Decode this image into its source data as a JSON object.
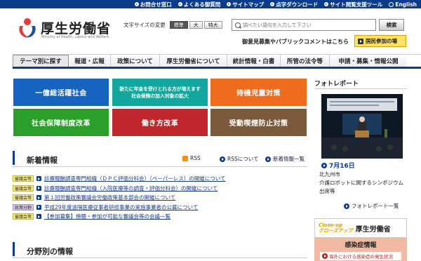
{
  "topbar": {
    "links": [
      {
        "label": "お問合せ窓口",
        "icon": "arrow-circle-icon"
      },
      {
        "label": "よくある御質問",
        "icon": "arrow-circle-icon"
      },
      {
        "label": "サイトマップ",
        "icon": "arrow-circle-icon"
      },
      {
        "label": "点字ダウンロード",
        "icon": "arrow-circle-icon"
      },
      {
        "label": "サイト閲覧支援ツール",
        "icon": "arrow-circle-icon"
      },
      {
        "label": "English",
        "icon": "globe-icon"
      }
    ]
  },
  "logo": {
    "name": "厚生労働省",
    "english": "Ministry of Health, Labour and Welfare"
  },
  "font_size": {
    "label": "文字サイズの変更",
    "options": [
      "標準",
      "大",
      "特大"
    ],
    "selected": "標準"
  },
  "search": {
    "placeholder": "調べたい語句を入力して下さい",
    "button": "検索"
  },
  "public_comment": "御意見募集やパブリックコメントはこちら",
  "kokumin_button": "国民参加の場",
  "nav": [
    "テーマ別に探す",
    "報道・広報",
    "政策について",
    "厚生労働省について",
    "統計情報・白書",
    "所管の法令等",
    "申請・募集・情報公開"
  ],
  "tiles": [
    {
      "label": "一億総活躍社会",
      "color": "#1565c0"
    },
    {
      "label": "新たに年金を受けとれる方が増えます\n社会保険の加入対象の拡大",
      "color": "#11a79f"
    },
    {
      "label": "待機児童対策",
      "color": "#ef6c1f"
    },
    {
      "label": "社会保障制度改革",
      "color": "#2aa02a"
    },
    {
      "label": "働き方改革",
      "color": "#c0272d"
    },
    {
      "label": "受動喫煙防止対策",
      "color": "#7b5a3c"
    }
  ],
  "news": {
    "title": "新着情報",
    "rss": "RSS",
    "rss_about": "RSSについて",
    "list_link": "新着情報一覧",
    "items": [
      {
        "tag": "審議会等",
        "text": "診療報酬調査専門組織（ＤＰＣ評価分科会）（ペーパーレス）の開催について"
      },
      {
        "tag": "審議会等",
        "text": "診療報酬調査専門組織（入院医療等の調査・評価分科会）の開催について"
      },
      {
        "tag": "審議会等",
        "text": "第１回労働政策審議会労働政策基本部会の開催について"
      },
      {
        "tag": "政策分野",
        "text": "平成29年度遠隔医療従事者研修事業の実施事業者の公募について"
      },
      {
        "tag": "審議会等",
        "text": "【参加募集】傍聴・参加が可能な審議会等の会議一覧"
      }
    ]
  },
  "field_info": {
    "title": "分野別の情報"
  },
  "photo_report": {
    "title": "フォトレポート",
    "date": "7月16日",
    "caption": "北九州市\n介護ロボットに関するシンポジウム出席等",
    "more": "フォトレポート一覧"
  },
  "closeup": {
    "accent": "Close-up\nクローズアップ",
    "name": "厚生労働省"
  },
  "infection": {
    "title": "感染症情報",
    "sub": "海外における感染症の発生状況"
  }
}
